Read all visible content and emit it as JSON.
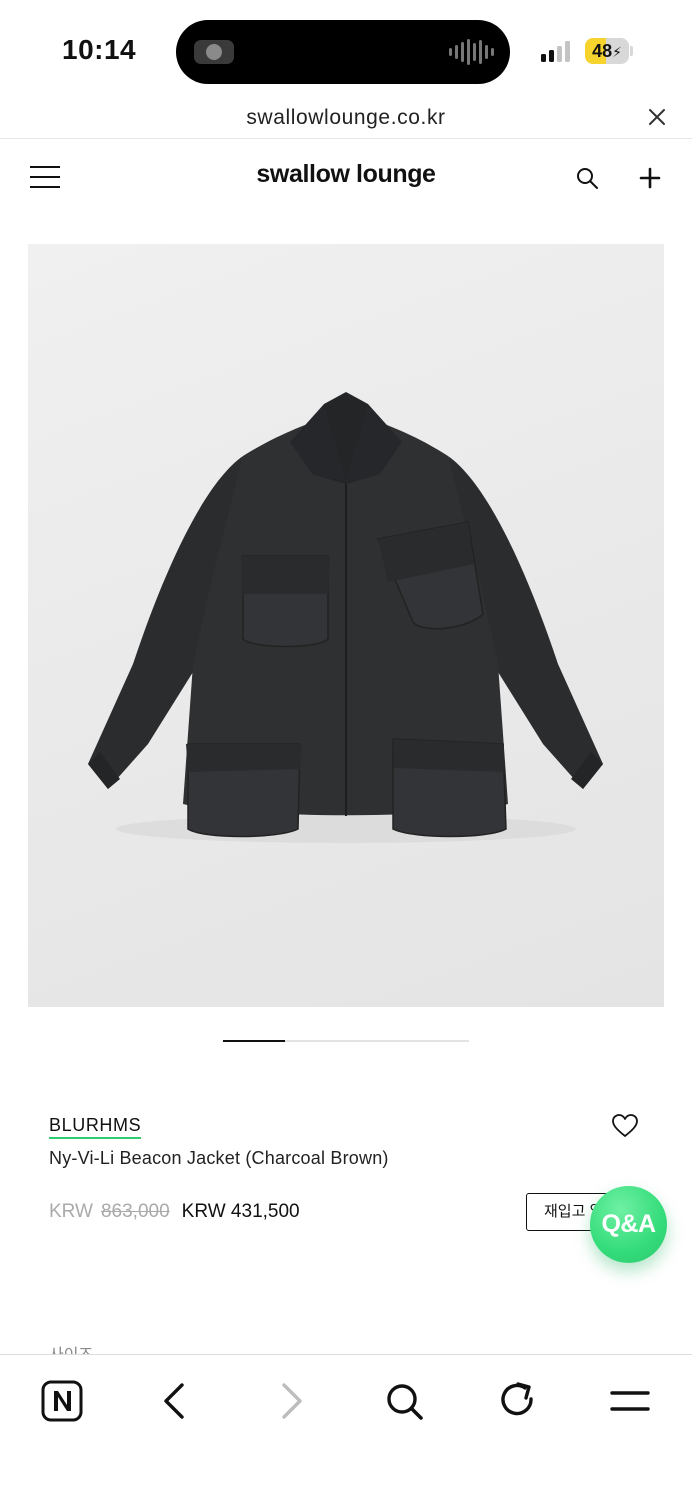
{
  "status_bar": {
    "time": "10:14",
    "battery": "48",
    "battery_level": 0.48,
    "signal_bars_active": 2,
    "signal_bars_total": 4
  },
  "browser": {
    "url": "swallowlounge.co.kr"
  },
  "site": {
    "brand": "swallow lounge"
  },
  "product": {
    "image_alt_icon": "jacket-image",
    "carousel_progress": 0.25,
    "brand": "BLURHMS",
    "name": "Ny-Vi-Li Beacon Jacket (Charcoal Brown)",
    "currency": "KRW",
    "original_price": "863,000",
    "sale_price": "KRW 431,500",
    "restock_label": "재입고 알림",
    "size_label": "사이즈"
  },
  "floating": {
    "qa_label": "Q&A"
  },
  "toolbar": {
    "items": [
      "naver-home-icon",
      "back-icon",
      "forward-icon",
      "search-icon",
      "refresh-icon",
      "menu-icon"
    ]
  },
  "colors": {
    "accent_green": "#2ecc71",
    "battery_yellow": "#f6d32d",
    "jacket": "#2d2e30"
  }
}
